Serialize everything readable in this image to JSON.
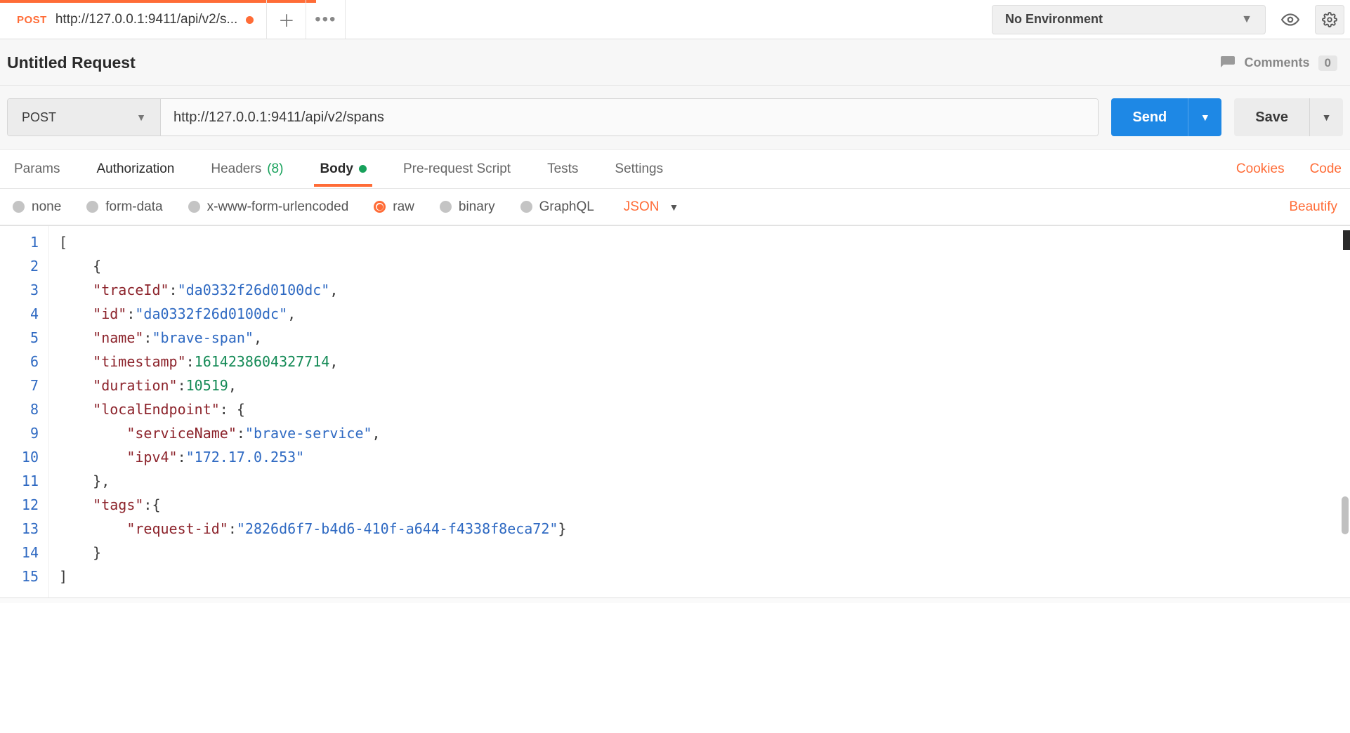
{
  "tab": {
    "method": "POST",
    "url_short": "http://127.0.0.1:9411/api/v2/s...",
    "dirty": true
  },
  "environment": {
    "label": "No Environment"
  },
  "title": "Untitled Request",
  "comments": {
    "label": "Comments",
    "count": "0"
  },
  "request": {
    "method": "POST",
    "url": "http://127.0.0.1:9411/api/v2/spans",
    "send_label": "Send",
    "save_label": "Save"
  },
  "req_tabs": {
    "params": "Params",
    "authorization": "Authorization",
    "headers": "Headers",
    "headers_count": "(8)",
    "body": "Body",
    "prerequest": "Pre-request Script",
    "tests": "Tests",
    "settings": "Settings",
    "cookies": "Cookies",
    "code": "Code"
  },
  "body_types": {
    "none": "none",
    "formdata": "form-data",
    "xform": "x-www-form-urlencoded",
    "raw": "raw",
    "binary": "binary",
    "graphql": "GraphQL",
    "subtype": "JSON",
    "beautify": "Beautify"
  },
  "editor": {
    "line_numbers": [
      "1",
      "2",
      "3",
      "4",
      "5",
      "6",
      "7",
      "8",
      "9",
      "10",
      "11",
      "12",
      "13",
      "14",
      "15"
    ],
    "lines": [
      [
        {
          "t": "punc",
          "v": "["
        }
      ],
      [
        {
          "t": "indent",
          "v": "    "
        },
        {
          "t": "punc",
          "v": "{"
        }
      ],
      [
        {
          "t": "indent",
          "v": "    "
        },
        {
          "t": "key",
          "v": "\"traceId\""
        },
        {
          "t": "punc",
          "v": ":"
        },
        {
          "t": "str",
          "v": "\"da0332f26d0100dc\""
        },
        {
          "t": "punc",
          "v": ","
        }
      ],
      [
        {
          "t": "indent",
          "v": "    "
        },
        {
          "t": "key",
          "v": "\"id\""
        },
        {
          "t": "punc",
          "v": ":"
        },
        {
          "t": "str",
          "v": "\"da0332f26d0100dc\""
        },
        {
          "t": "punc",
          "v": ","
        }
      ],
      [
        {
          "t": "indent",
          "v": "    "
        },
        {
          "t": "key",
          "v": "\"name\""
        },
        {
          "t": "punc",
          "v": ":"
        },
        {
          "t": "str",
          "v": "\"brave-span\""
        },
        {
          "t": "punc",
          "v": ","
        }
      ],
      [
        {
          "t": "indent",
          "v": "    "
        },
        {
          "t": "key",
          "v": "\"timestamp\""
        },
        {
          "t": "punc",
          "v": ":"
        },
        {
          "t": "num",
          "v": "1614238604327714"
        },
        {
          "t": "punc",
          "v": ","
        }
      ],
      [
        {
          "t": "indent",
          "v": "    "
        },
        {
          "t": "key",
          "v": "\"duration\""
        },
        {
          "t": "punc",
          "v": ":"
        },
        {
          "t": "num",
          "v": "10519"
        },
        {
          "t": "punc",
          "v": ","
        }
      ],
      [
        {
          "t": "indent",
          "v": "    "
        },
        {
          "t": "key",
          "v": "\"localEndpoint\""
        },
        {
          "t": "punc",
          "v": ": {"
        }
      ],
      [
        {
          "t": "indent",
          "v": "        "
        },
        {
          "t": "key",
          "v": "\"serviceName\""
        },
        {
          "t": "punc",
          "v": ":"
        },
        {
          "t": "str",
          "v": "\"brave-service\""
        },
        {
          "t": "punc",
          "v": ","
        }
      ],
      [
        {
          "t": "indent",
          "v": "        "
        },
        {
          "t": "key",
          "v": "\"ipv4\""
        },
        {
          "t": "punc",
          "v": ":"
        },
        {
          "t": "str",
          "v": "\"172.17.0.253\""
        }
      ],
      [
        {
          "t": "indent",
          "v": "    "
        },
        {
          "t": "punc",
          "v": "},"
        }
      ],
      [
        {
          "t": "indent",
          "v": "    "
        },
        {
          "t": "key",
          "v": "\"tags\""
        },
        {
          "t": "punc",
          "v": ":{"
        }
      ],
      [
        {
          "t": "indent",
          "v": "        "
        },
        {
          "t": "key",
          "v": "\"request-id\""
        },
        {
          "t": "punc",
          "v": ":"
        },
        {
          "t": "str",
          "v": "\"2826d6f7-b4d6-410f-a644-f4338f8eca72\""
        },
        {
          "t": "punc",
          "v": "}"
        }
      ],
      [
        {
          "t": "indent",
          "v": "    "
        },
        {
          "t": "punc",
          "v": "}"
        }
      ],
      [
        {
          "t": "punc",
          "v": "]"
        }
      ]
    ]
  }
}
